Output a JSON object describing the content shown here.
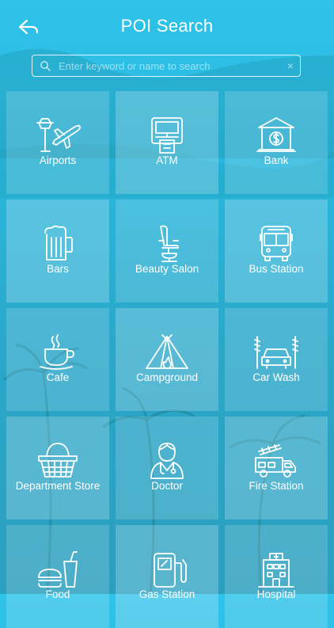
{
  "header": {
    "title": "POI Search",
    "back_icon": "back-arrow-icon"
  },
  "search": {
    "placeholder": "Enter keyword or name to search",
    "value": "",
    "clear_symbol": "×"
  },
  "categories": [
    {
      "label": "Airports",
      "icon": "airport-icon"
    },
    {
      "label": "ATM",
      "icon": "atm-icon"
    },
    {
      "label": "Bank",
      "icon": "bank-icon"
    },
    {
      "label": "Bars",
      "icon": "beer-mug-icon"
    },
    {
      "label": "Beauty Salon",
      "icon": "salon-chair-icon"
    },
    {
      "label": "Bus Station",
      "icon": "bus-icon"
    },
    {
      "label": "Cafe",
      "icon": "coffee-cup-icon"
    },
    {
      "label": "Campground",
      "icon": "tent-icon"
    },
    {
      "label": "Car Wash",
      "icon": "car-wash-icon"
    },
    {
      "label": "Department Store",
      "icon": "shopping-basket-icon"
    },
    {
      "label": "Doctor",
      "icon": "doctor-icon"
    },
    {
      "label": "Fire Station",
      "icon": "fire-truck-icon"
    },
    {
      "label": "Food",
      "icon": "fast-food-icon"
    },
    {
      "label": "Gas Station",
      "icon": "gas-pump-icon"
    },
    {
      "label": "Hospital",
      "icon": "hospital-icon"
    }
  ],
  "colors": {
    "background_top": "#2fc3ea",
    "background_bottom": "#2b9fbf",
    "text": "#ffffff"
  }
}
